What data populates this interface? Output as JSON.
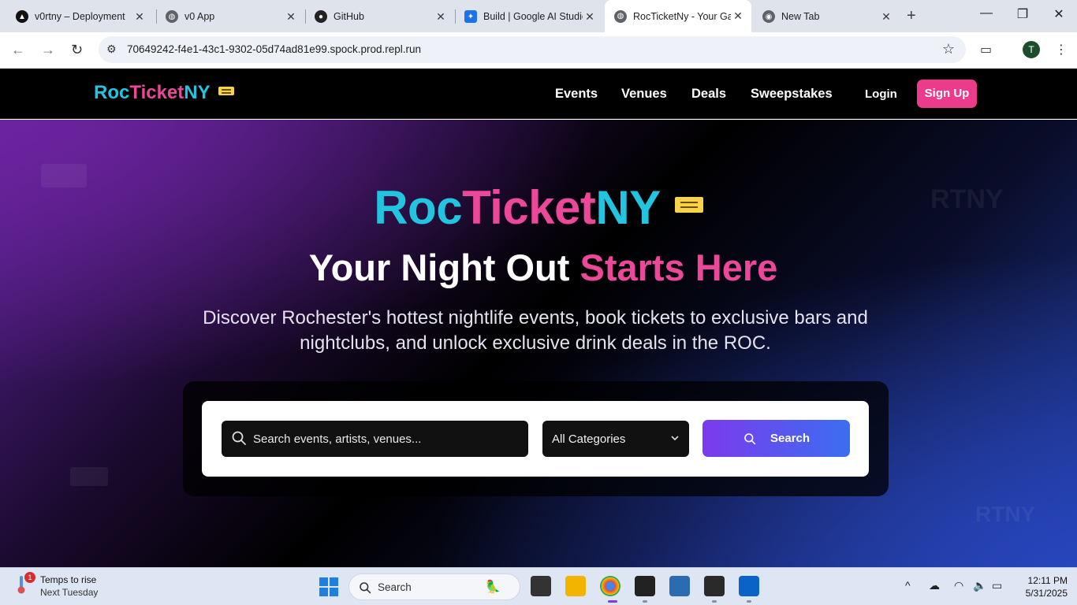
{
  "browser": {
    "tabs": [
      {
        "title": "v0rtny – Deployment",
        "favicon": "vercel-icon"
      },
      {
        "title": "v0 App",
        "favicon": "globe-icon"
      },
      {
        "title": "GitHub",
        "favicon": "github-icon"
      },
      {
        "title": "Build | Google AI Studio",
        "favicon": "ai-studio-icon"
      },
      {
        "title": "RocTicketNy - Your Ga",
        "favicon": "globe-icon",
        "active": true
      },
      {
        "title": "New Tab",
        "favicon": "chrome-icon"
      }
    ],
    "url": "70649242-f4e1-43c1-9302-05d74ad81e99.spock.prod.repl.run",
    "profile_initial": "T"
  },
  "site": {
    "logo": {
      "part1": "Roc",
      "part2": "Ticket",
      "part3": "NY"
    },
    "nav": [
      "Events",
      "Venues",
      "Deals",
      "Sweepstakes"
    ],
    "login": "Login",
    "signup": "Sign Up",
    "hero": {
      "title_part1": "Roc",
      "title_part2": "Ticket",
      "title_part3": "NY",
      "subtitle_white": "Your Night Out ",
      "subtitle_pink": "Starts Here",
      "description": "Discover Rochester's hottest nightlife events, book tickets to exclusive bars and nightclubs, and unlock exclusive drink deals in the ROC.",
      "watermark": "RTNY"
    },
    "search": {
      "placeholder": "Search events, artists, venues...",
      "category": "All Categories",
      "button": "Search"
    }
  },
  "taskbar": {
    "weather_line1": "Temps to rise",
    "weather_line2": "Next Tuesday",
    "weather_badge": "1",
    "search_label": "Search",
    "time": "12:11 PM",
    "date": "5/31/2025"
  },
  "colors": {
    "cyan": "#22c4e0",
    "pink": "#ec4899",
    "signup": "#ec3b8b",
    "search_btn_start": "#7c3aed",
    "search_btn_end": "#3b6ef0"
  }
}
